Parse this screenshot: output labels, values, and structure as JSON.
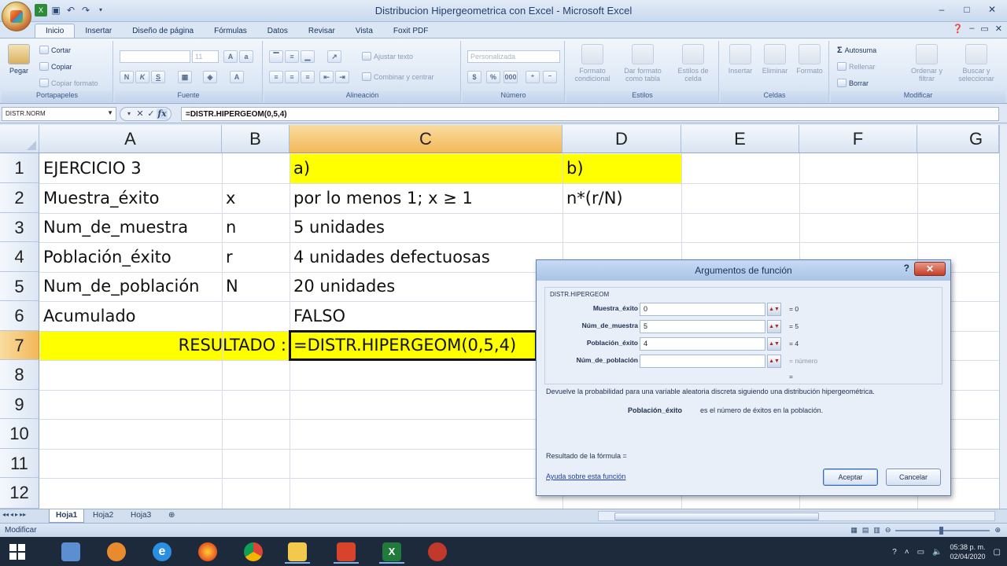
{
  "window": {
    "title": "Distribucion Hipergeometrica con Excel - Microsoft Excel",
    "controls": [
      "–",
      "□",
      "✕"
    ]
  },
  "ribbon": {
    "tabs": [
      "Inicio",
      "Insertar",
      "Diseño de página",
      "Fórmulas",
      "Datos",
      "Revisar",
      "Vista",
      "Foxit PDF"
    ],
    "active_tab": "Inicio",
    "groups": {
      "clipboard": {
        "label": "Portapapeles",
        "paste": "Pegar",
        "cut": "Cortar",
        "copy": "Copiar",
        "format_painter": "Copiar formato"
      },
      "font": {
        "label": "Fuente",
        "font_name": "",
        "font_size": "11"
      },
      "alignment": {
        "label": "Alineación",
        "wrap": "Ajustar texto",
        "merge": "Combinar y centrar"
      },
      "number": {
        "label": "Número",
        "format": "Personalizada"
      },
      "styles": {
        "label": "Estilos",
        "conditional": "Formato condicional",
        "as_table": "Dar formato como tabla",
        "cell_styles": "Estilos de celda"
      },
      "cells": {
        "label": "Celdas",
        "insert": "Insertar",
        "delete": "Eliminar",
        "format": "Formato"
      },
      "editing": {
        "label": "Modificar",
        "autosum": "Autosuma",
        "fill": "Rellenar",
        "clear": "Borrar",
        "sort": "Ordenar y filtrar",
        "find": "Buscar y seleccionar"
      }
    }
  },
  "formula_bar": {
    "name_box": "DISTR.NORM",
    "formula": "=DISTR.HIPERGEOM(0,5,4)"
  },
  "grid": {
    "columns": [
      "A",
      "B",
      "C",
      "D",
      "E",
      "F",
      "G"
    ],
    "rows": [
      "1",
      "2",
      "3",
      "4",
      "5",
      "6",
      "7",
      "8",
      "9",
      "10",
      "11",
      "12"
    ],
    "selected_column": "C",
    "selected_row": "7",
    "cells": {
      "A1": "EJERCICIO 3",
      "C1": "a)",
      "D1": "b)",
      "A2": "Muestra_éxito",
      "B2": "x",
      "C2": "por lo menos 1; x ≥ 1",
      "D2": "n*(r/N)",
      "A3": "Num_de_muestra",
      "B3": "n",
      "C3": "5 unidades",
      "A4": "Población_éxito",
      "B4": "r",
      "C4": "4 unidades defectuosas",
      "A5": "Num_de_población",
      "B5": "N",
      "C5": "20 unidades",
      "A6": "Acumulado",
      "C6": "FALSO",
      "B7": "RESULTADO :",
      "C7": "=DISTR.HIPERGEOM(0,5,4)"
    },
    "highlight_color": "#ffff00"
  },
  "sheets": {
    "tabs": [
      "Hoja1",
      "Hoja2",
      "Hoja3"
    ],
    "active": "Hoja1"
  },
  "status": {
    "mode": "Modificar"
  },
  "dialog": {
    "title": "Argumentos de función",
    "help_glyph": "?",
    "close_glyph": "✕",
    "function_name": "DISTR.HIPERGEOM",
    "args": [
      {
        "label": "Muestra_éxito",
        "value": "0",
        "result": "= 0"
      },
      {
        "label": "Núm_de_muestra",
        "value": "5",
        "result": "= 5"
      },
      {
        "label": "Población_éxito",
        "value": "4",
        "result": "= 4"
      },
      {
        "label": "Núm_de_población",
        "value": "",
        "result": "= número"
      }
    ],
    "overall_result": "=",
    "description": "Devuelve la probabilidad para una variable aleatoria discreta siguiendo una distribución hipergeométrica.",
    "arg_name": "Población_éxito",
    "arg_help": "es el número de éxitos en la población.",
    "formula_result": "Resultado de la fórmula =",
    "help_link": "Ayuda sobre esta función",
    "ok": "Aceptar",
    "cancel": "Cancelar"
  },
  "taskbar": {
    "time": "05:38 p. m.",
    "date": "02/04/2020"
  }
}
